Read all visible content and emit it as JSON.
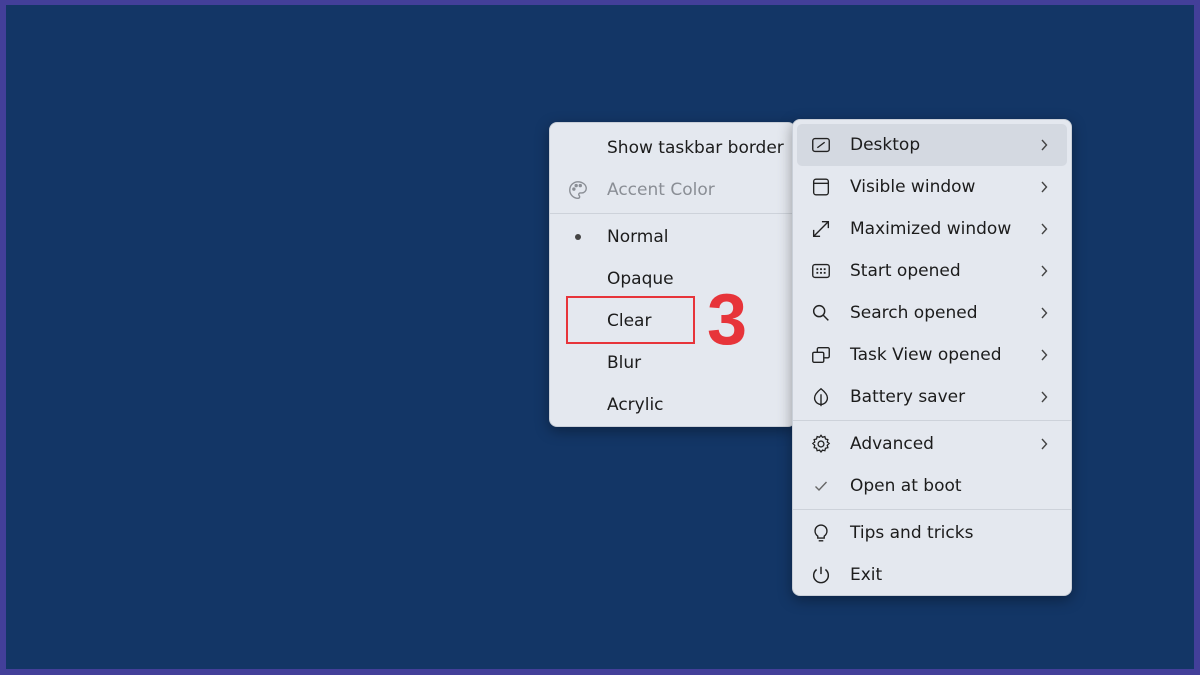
{
  "submenu": {
    "items": [
      {
        "label": "Show taskbar border"
      },
      {
        "label": "Accent Color"
      },
      {
        "label": "Normal"
      },
      {
        "label": "Opaque"
      },
      {
        "label": "Clear"
      },
      {
        "label": "Blur"
      },
      {
        "label": "Acrylic"
      }
    ]
  },
  "mainmenu": {
    "items": [
      {
        "label": "Desktop",
        "icon": "desktop-icon"
      },
      {
        "label": "Visible window",
        "icon": "window-icon"
      },
      {
        "label": "Maximized window",
        "icon": "maximize-icon"
      },
      {
        "label": "Start opened",
        "icon": "start-icon"
      },
      {
        "label": "Search opened",
        "icon": "search-icon"
      },
      {
        "label": "Task View opened",
        "icon": "task-view-icon"
      },
      {
        "label": "Battery saver",
        "icon": "leaf-icon"
      },
      {
        "label": "Advanced",
        "icon": "gear-icon"
      },
      {
        "label": "Open at boot",
        "icon": "check-icon"
      },
      {
        "label": "Tips and tricks",
        "icon": "lightbulb-icon"
      },
      {
        "label": "Exit",
        "icon": "power-icon"
      }
    ]
  },
  "annotation": {
    "step_number": "3"
  },
  "colors": {
    "desktop": "#133666",
    "border": "#433f99",
    "menu": "#e4e8ef",
    "highlight": "#e7343a"
  }
}
